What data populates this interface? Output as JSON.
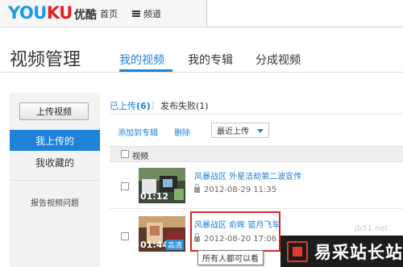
{
  "topbar": {
    "logo_you": "YOU",
    "logo_ku": "KU",
    "logo_cn": "优酷",
    "home": "首页",
    "channel": "频道"
  },
  "header": {
    "title": "视频管理",
    "tabs": [
      {
        "label": "我的视频",
        "active": true
      },
      {
        "label": "我的专辑",
        "active": false
      },
      {
        "label": "分成视频",
        "active": false
      }
    ]
  },
  "sidebar": {
    "upload_button": "上传视频",
    "items": [
      {
        "label": "我上传的",
        "active": true
      },
      {
        "label": "我收藏的",
        "active": false
      }
    ],
    "report": "报告视频问题"
  },
  "subtabs": {
    "uploaded_label": "已上传",
    "uploaded_count": "(6)",
    "separator": "|",
    "failed": "发布失败(1)"
  },
  "actions": {
    "add_to_album": "添加到专辑",
    "delete": "删除",
    "sort_selected": "最近上传"
  },
  "list": {
    "header": "视频",
    "rows": [
      {
        "title": "风暴战区 外星洁劫第二波宣传",
        "date": "2012-08-29 11:35",
        "duration": "01:12",
        "hd_badge": ""
      },
      {
        "title": "风暴战区 俞晖 篮月飞车",
        "date": "2012-08-20 17:06",
        "duration": "01:44",
        "hd_badge": "高清"
      }
    ]
  },
  "tooltip": "所有人都可以看",
  "watermark": {
    "faint": "jb51.net",
    "text": "易采站长站"
  },
  "colors": {
    "accent": "#1d82d8",
    "highlight": "#d9262a",
    "logo_blue": "#1a9be2",
    "logo_red": "#e4201f"
  }
}
